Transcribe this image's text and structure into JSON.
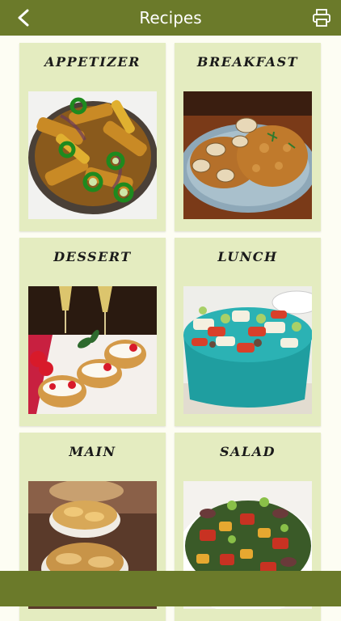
{
  "header": {
    "title": "Recipes",
    "back_icon": "chevron-left-icon",
    "print_icon": "printer-icon"
  },
  "categories": [
    {
      "label": "APPETIZER",
      "photo": "roasted potato wedges with green chili rings"
    },
    {
      "label": "BREAKFAST",
      "photo": "hash brown patties with mushroom gravy"
    },
    {
      "label": "DESSERT",
      "photo": "cream puffs with strawberries and champagne"
    },
    {
      "label": "LUNCH",
      "photo": "chopped salad in teal bowl"
    },
    {
      "label": "MAIN",
      "photo": "baked pot pies"
    },
    {
      "label": "SALAD",
      "photo": "roasted vegetable salad"
    }
  ],
  "colors": {
    "bar": "#6b7a2a",
    "card": "#e4ecc0",
    "background": "#fdfdf3"
  }
}
